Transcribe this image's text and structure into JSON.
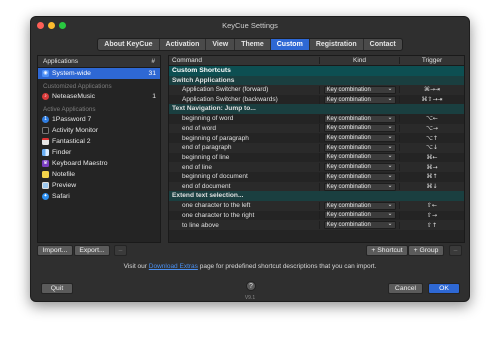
{
  "window": {
    "title": "KeyCue Settings"
  },
  "tabs": [
    "About KeyCue",
    "Activation",
    "View",
    "Theme",
    "Custom",
    "Registration",
    "Contact"
  ],
  "active_tab": "Custom",
  "apps_panel": {
    "col_applications": "Applications",
    "col_count": "#",
    "system_wide": {
      "label": "System-wide",
      "count": "31"
    },
    "customized_group": "Customized Applications",
    "customized": [
      {
        "label": "NeteaseMusic",
        "count": "1",
        "icon": "music-icon"
      }
    ],
    "active_group": "Active Applications",
    "active": [
      {
        "label": "1Password 7",
        "icon": "lock-icon"
      },
      {
        "label": "Activity Monitor",
        "icon": "monitor-icon"
      },
      {
        "label": "Fantastical 2",
        "icon": "calendar-icon"
      },
      {
        "label": "Finder",
        "icon": "finder-icon"
      },
      {
        "label": "Keyboard Maestro",
        "icon": "crown-icon"
      },
      {
        "label": "Notefile",
        "icon": "note-icon"
      },
      {
        "label": "Preview",
        "icon": "preview-icon"
      },
      {
        "label": "Safari",
        "icon": "compass-icon"
      }
    ]
  },
  "shortcuts": {
    "col_command": "Command",
    "col_kind": "Kind",
    "col_trigger": "Trigger",
    "title": "Custom Shortcuts",
    "sections": [
      {
        "name": "Switch Applications",
        "rows": [
          {
            "command": "Application Switcher (forward)",
            "kind": "Key combination",
            "trigger": "⌘→⇥"
          },
          {
            "command": "Application Switcher (backwards)",
            "kind": "Key combination",
            "trigger": "⌘⇧→⇥"
          }
        ]
      },
      {
        "name": "Text Navigation: Jump to...",
        "rows": [
          {
            "command": "beginning of word",
            "kind": "Key combination",
            "trigger": "⌥←"
          },
          {
            "command": "end of word",
            "kind": "Key combination",
            "trigger": "⌥→"
          },
          {
            "command": "beginning of paragraph",
            "kind": "Key combination",
            "trigger": "⌥↑"
          },
          {
            "command": "end of paragraph",
            "kind": "Key combination",
            "trigger": "⌥↓"
          },
          {
            "command": "beginning of line",
            "kind": "Key combination",
            "trigger": "⌘←"
          },
          {
            "command": "end of line",
            "kind": "Key combination",
            "trigger": "⌘→"
          },
          {
            "command": "beginning of document",
            "kind": "Key combination",
            "trigger": "⌘↑"
          },
          {
            "command": "end of document",
            "kind": "Key combination",
            "trigger": "⌘↓"
          }
        ]
      },
      {
        "name": "Extend text selection...",
        "rows": [
          {
            "command": "one character to the left",
            "kind": "Key combination",
            "trigger": "⇧←"
          },
          {
            "command": "one character to the right",
            "kind": "Key combination",
            "trigger": "⇧→"
          },
          {
            "command": "to line above",
            "kind": "Key combination",
            "trigger": "⇧↑"
          }
        ]
      }
    ]
  },
  "buttons": {
    "import": "Import...",
    "export": "Export...",
    "remove_app": "–",
    "add_shortcut": "+ Shortcut",
    "add_group": "+ Group",
    "remove_shortcut": "–",
    "quit": "Quit",
    "cancel": "Cancel",
    "ok": "OK",
    "help": "?"
  },
  "footer": {
    "prefix": "Visit our ",
    "link": "Download Extras",
    "suffix": " page for predefined shortcut descriptions that you can import.",
    "version": "V9.1"
  },
  "colors": {
    "accent": "#2e68d4",
    "group_bg": "#0d4f52",
    "window_bg": "#2f2f2f"
  }
}
